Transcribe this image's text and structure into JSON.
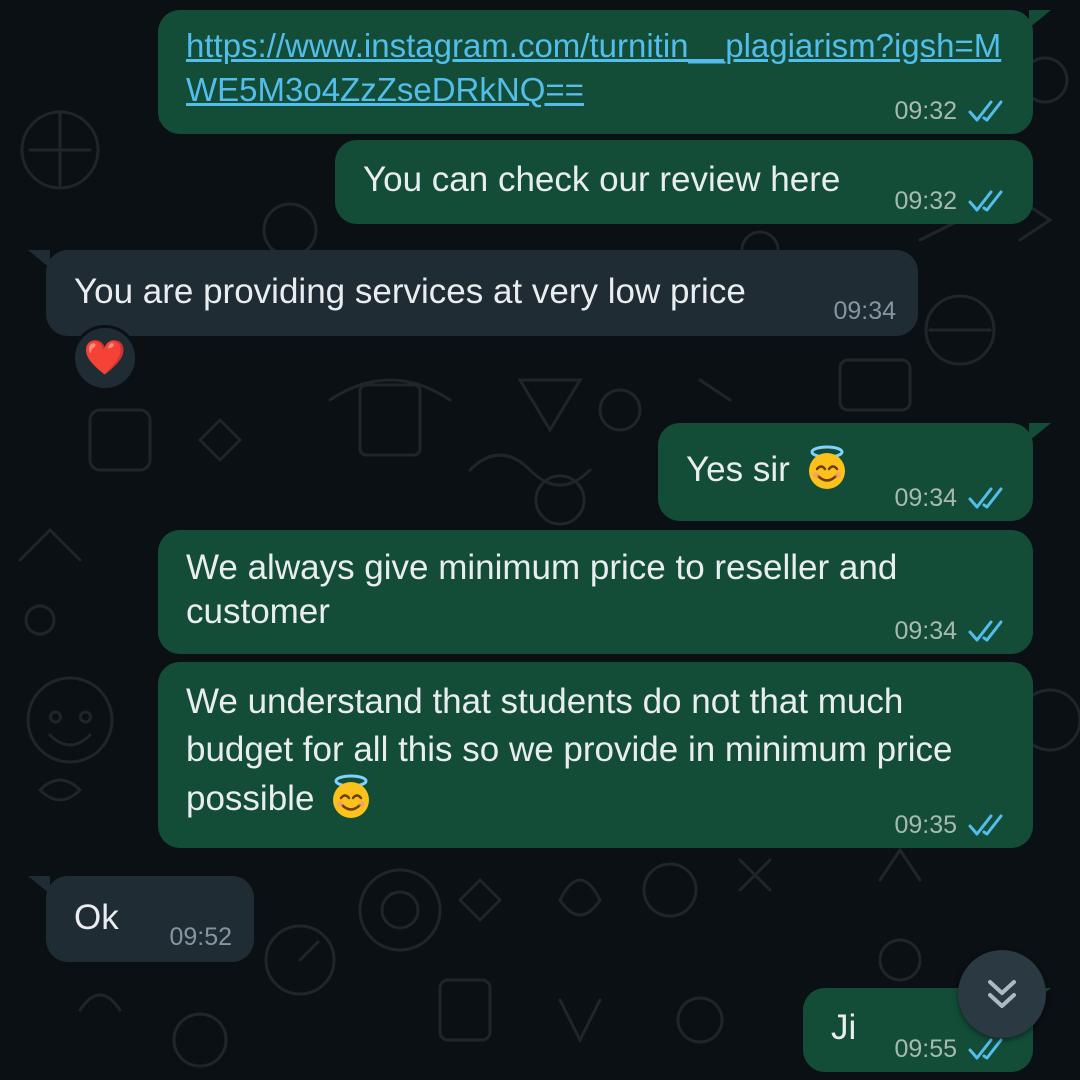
{
  "colors": {
    "outgoing_bubble": "#144d37",
    "incoming_bubble": "#202c33",
    "background": "#0b1014",
    "link": "#53bdeb",
    "read_ticks": "#53bdeb"
  },
  "messages": [
    {
      "direction": "outgoing",
      "text": "https://www.instagram.com/turnitin__plagiarism?igsh=MWE5M3o4ZzZseDRkNQ==",
      "is_link": true,
      "time": "09:32",
      "status": "read"
    },
    {
      "direction": "outgoing",
      "text": "You can check our review here",
      "time": "09:32",
      "status": "read"
    },
    {
      "direction": "incoming",
      "text": "You are providing services at very low price",
      "time": "09:34",
      "reaction": "❤️"
    },
    {
      "direction": "outgoing",
      "text": "Yes sir",
      "emoji": "smiling-face-with-halo",
      "time": "09:34",
      "status": "read"
    },
    {
      "direction": "outgoing",
      "text": "We always give minimum price to reseller and customer",
      "time": "09:34",
      "status": "read"
    },
    {
      "direction": "outgoing",
      "text": "We understand that students do not that much budget for all this so we provide in minimum price possible",
      "emoji": "smiling-face-with-halo",
      "time": "09:35",
      "status": "read"
    },
    {
      "direction": "incoming",
      "text": "Ok",
      "time": "09:52"
    },
    {
      "direction": "outgoing",
      "text": "Ji",
      "time": "09:55",
      "status": "read"
    }
  ],
  "icons": {
    "scroll_down": "double-chevron-down-icon",
    "read_receipt": "double-check-icon"
  }
}
